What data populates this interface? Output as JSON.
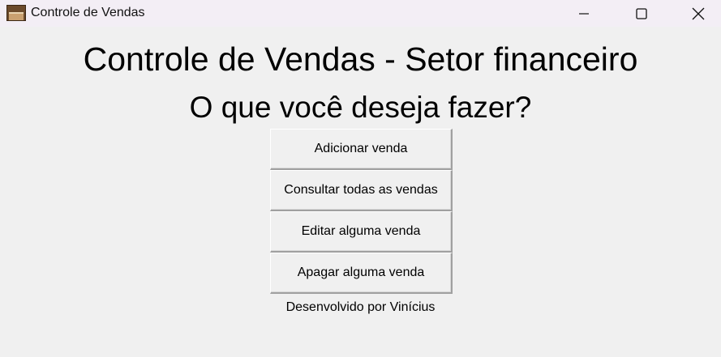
{
  "window": {
    "title": "Controle de Vendas",
    "icon": "bookshelf-app-icon",
    "controls": [
      "minimize-icon",
      "maximize-icon",
      "close-icon"
    ]
  },
  "main": {
    "title": "Controle de Vendas - Setor financeiro",
    "subtitle": "O que você deseja fazer?",
    "buttons": [
      {
        "label": "Adicionar venda"
      },
      {
        "label": "Consultar todas as vendas"
      },
      {
        "label": "Editar alguma venda"
      },
      {
        "label": "Apagar alguma venda"
      }
    ],
    "footer": "Desenvolvido por Vinícius"
  }
}
